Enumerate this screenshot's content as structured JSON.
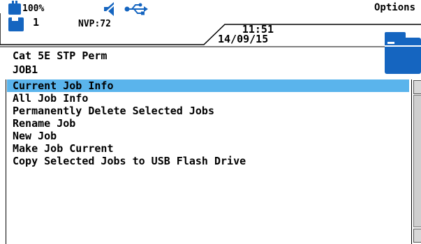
{
  "status_bar": {
    "battery_percent": "100%",
    "icons": [
      "battery-icon",
      "speaker-muted-icon",
      "usb-icon",
      "job-folder-icon",
      "options-folder-icon"
    ],
    "options_label": "Options"
  },
  "info_bar": {
    "job_count": "1",
    "nvp": "NVP:72",
    "time": "11:51",
    "date": "14/09/15"
  },
  "header": {
    "cable_type": "Cat 5E STP Perm",
    "job_name": "JOB1"
  },
  "menu": {
    "selected_index": 0,
    "items": [
      "Current Job Info",
      "All Job Info",
      "Permanently Delete Selected Jobs",
      "Rename Job",
      "New Job",
      "Make Job Current",
      "Copy Selected Jobs to USB Flash Drive"
    ]
  },
  "colors": {
    "selection": "#5ab4ec",
    "icon_blue": "#1565c0"
  }
}
